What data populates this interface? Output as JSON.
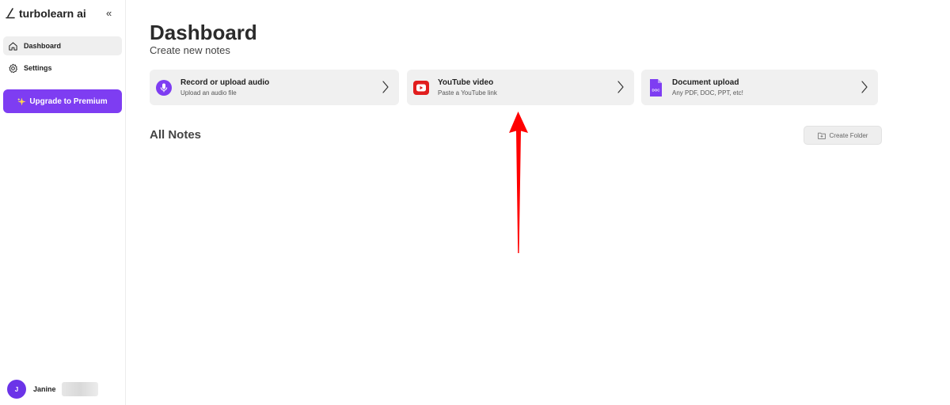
{
  "sidebar": {
    "brand": "turbolearn ai",
    "collapse_glyph": "«",
    "nav": [
      {
        "label": "Dashboard",
        "icon": "home-icon",
        "active": true
      },
      {
        "label": "Settings",
        "icon": "gear-icon",
        "active": false
      }
    ],
    "upgrade": {
      "label": "Upgrade to Premium",
      "icon": "sparkle-icon"
    },
    "user": {
      "initial": "J",
      "name": "Janine"
    }
  },
  "main": {
    "title": "Dashboard",
    "subtitle": "Create new notes",
    "cards": [
      {
        "title": "Record or upload audio",
        "subtitle": "Upload an audio file",
        "icon": "microphone-icon"
      },
      {
        "title": "YouTube video",
        "subtitle": "Paste a YouTube link",
        "icon": "youtube-icon"
      },
      {
        "title": "Document upload",
        "subtitle": "Any PDF, DOC, PPT, etc!",
        "icon": "document-icon",
        "icon_text": "DOC"
      }
    ],
    "section_title": "All Notes",
    "create_folder_label": "Create Folder"
  },
  "colors": {
    "accent": "#7e3df2",
    "youtube_red": "#e11d1d",
    "annotation_arrow": "#ff0000",
    "card_bg": "#f0f0f0"
  }
}
